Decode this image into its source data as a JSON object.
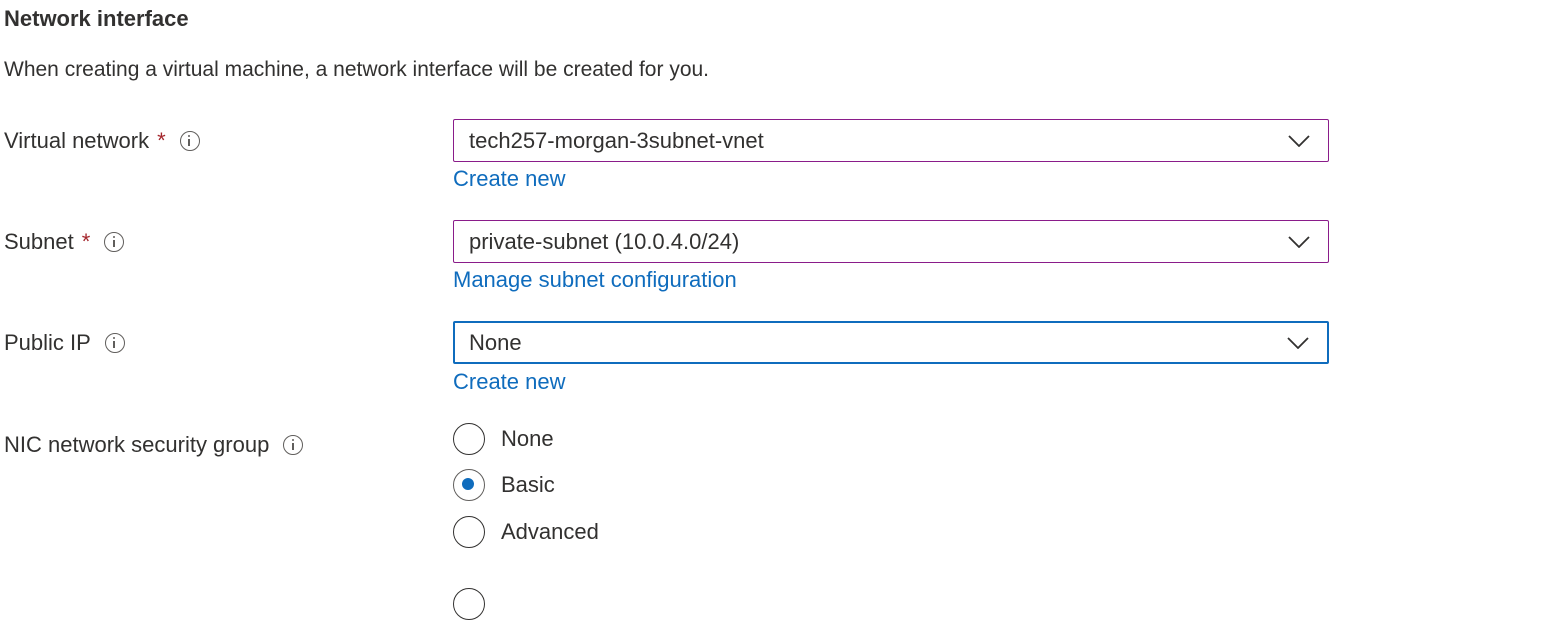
{
  "section": {
    "title": "Network interface",
    "description": "When creating a virtual machine, a network interface will be created for you."
  },
  "fields": {
    "virtual_network": {
      "label": "Virtual network",
      "required": "*",
      "icon": "info-icon",
      "value": "tech257-morgan-3subnet-vnet",
      "link": "Create new"
    },
    "subnet": {
      "label": "Subnet",
      "required": "*",
      "icon": "info-icon",
      "value": "private-subnet (10.0.4.0/24)",
      "link": "Manage subnet configuration"
    },
    "public_ip": {
      "label": "Public IP",
      "icon": "info-icon",
      "value": "None",
      "link": "Create new"
    },
    "nic_nsg": {
      "label": "NIC network security group",
      "icon": "info-icon",
      "options": [
        "None",
        "Basic",
        "Advanced"
      ],
      "selected": "Basic"
    }
  },
  "colors": {
    "accent": "#0f6cbd",
    "required": "#a4262c",
    "dropdown_border": "#8a1c8a"
  }
}
